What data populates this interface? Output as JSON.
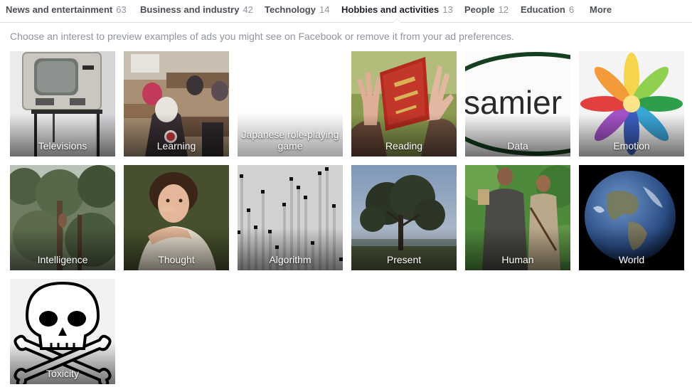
{
  "tabs": [
    {
      "label": "News and entertainment",
      "count": "63"
    },
    {
      "label": "Business and industry",
      "count": "42"
    },
    {
      "label": "Technology",
      "count": "14"
    },
    {
      "label": "Hobbies and activities",
      "count": "13"
    },
    {
      "label": "People",
      "count": "12"
    },
    {
      "label": "Education",
      "count": "6"
    },
    {
      "label": "More",
      "count": ""
    }
  ],
  "description": "Choose an interest to preview examples of ads you might see on Facebook or remove it from your ad preferences.",
  "tiles": [
    {
      "label": "Televisions",
      "icon": "television-photo"
    },
    {
      "label": "Learning",
      "icon": "classroom-photo"
    },
    {
      "label": "Japanese role-playing game",
      "icon": "blank-image"
    },
    {
      "label": "Reading",
      "icon": "book-reader-photo"
    },
    {
      "label": "Data",
      "icon": "text-logo-image"
    },
    {
      "label": "Emotion",
      "icon": "emotion-wheel-image"
    },
    {
      "label": "Intelligence",
      "icon": "tree-climbing-photo"
    },
    {
      "label": "Thought",
      "icon": "portrait-painting"
    },
    {
      "label": "Algorithm",
      "icon": "sorting-bars-image"
    },
    {
      "label": "Present",
      "icon": "tree-landscape-photo"
    },
    {
      "label": "Human",
      "icon": "people-photo"
    },
    {
      "label": "World",
      "icon": "earth-globe-image"
    },
    {
      "label": "Toxicity",
      "icon": "skull-crossbones-icon"
    }
  ],
  "tile_text": {
    "data_logo": "samier"
  }
}
